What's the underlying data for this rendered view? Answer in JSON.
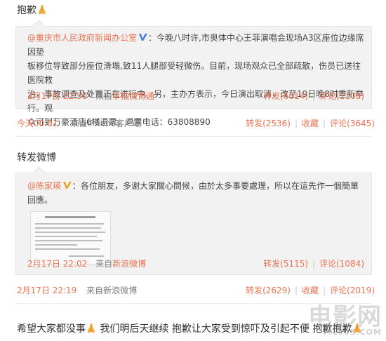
{
  "post1": {
    "text": "抱歉",
    "emoji_icon": "praying-hands-icon",
    "repost": {
      "author": "@重庆市人民政府新闻办公室",
      "verified_icon": "verified-v-icon",
      "body_suffix": "：今晚八时许,市奥体中心王菲演唱会现场A3区座位边缘席因垫板移位导致部分座位滑塌,致11人腿部受轻微伤。目前，现场观众已全部疏散，伤员已送往医院救治，事故调查及处置正在进行中。另，主办方表示，今日演出取消，改至19日晚8时重新举行。观众可到万豪酒店6楼退票，退票电话：63808890",
      "lines": [
        "：今晚八时许,市奥体中心王菲演唱会现场A3区座位边缘席因垫",
        "板移位导致部分座位滑塌,致11人腿部受轻微伤。目前，现场观众已全部疏散，伤员已送往医院救",
        "治，事故调查及处置正在进行中。另，主办方表示，今日演出取消，改至19日晚8时重新举行。观",
        "众可到万豪酒店6楼退票，退票电话：63808890"
      ],
      "time": "2月17日 22:50",
      "source_prefix": "来自",
      "source": "享拍微博通",
      "repost_label": "转发(6014)",
      "comment_label": "评论(1108)"
    },
    "time": "今天00:01",
    "source": "来自iPhone客户端",
    "repost_label": "转发(2536)",
    "collect_label": "收藏",
    "comment_label": "评论(3645)"
  },
  "post2": {
    "text": "转发微博",
    "repost": {
      "author": "@陈家瑛",
      "verified_icon": "verified-v-icon",
      "body": "：各位朋友，多谢大家關心問候，由於太多事要處理，所以在這先作一個簡單回應。",
      "thumbnail_icon": "letter-image-thumbnail-icon",
      "time": "2月17日 22:02",
      "source_prefix": "来自",
      "source": "新浪微博",
      "repost_label": "转发(5115)",
      "comment_label": "评论(1084)"
    },
    "time": "2月17日 22:19",
    "source": "来自新浪微博",
    "repost_label": "转发(2629)",
    "collect_label": "收藏",
    "comment_label": "评论(2019)"
  },
  "post3": {
    "part1": "希望大家都没事",
    "part2": " 我们明后天继续 抱歉让大家受到惊吓及引起不便 抱歉抱歉",
    "emoji_icon": "praying-hands-icon"
  },
  "watermark": {
    "main": "电影网",
    "sub": "M1905.COM"
  },
  "colors": {
    "link": "#eb7350",
    "meta": "#808080",
    "box_bg": "#f2f2f2"
  }
}
